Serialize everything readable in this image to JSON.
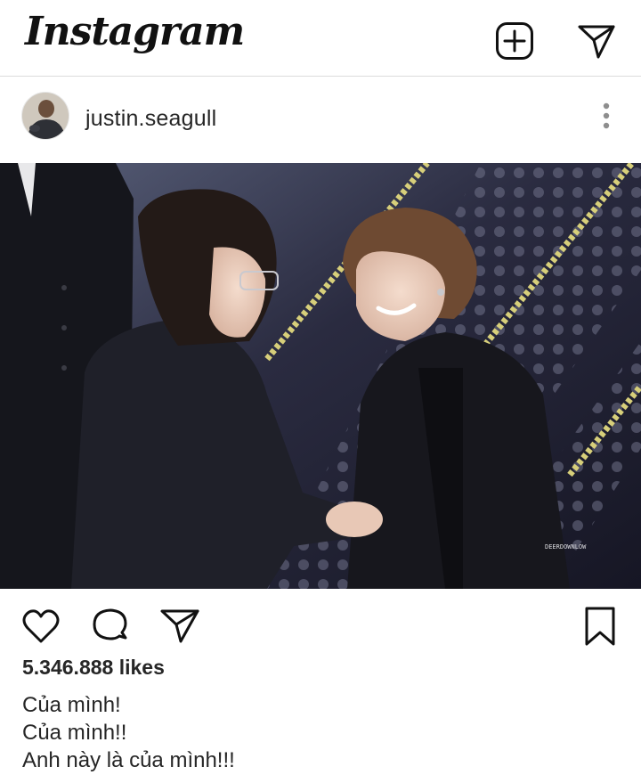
{
  "app": {
    "logo_text": "Instagram"
  },
  "topbar": {
    "icons": [
      "new-post-icon",
      "direct-message-icon"
    ]
  },
  "post": {
    "username": "justin.seagull",
    "likes": "5.346.888 likes",
    "caption_lines": [
      "Của mình!",
      "Của mình!!",
      "Anh này là của mình!!!"
    ],
    "watermark": "DEERDOWNLOW"
  },
  "actions": {
    "icons": [
      "heart-icon",
      "comment-icon",
      "share-icon",
      "bookmark-icon",
      "more-options-icon"
    ]
  },
  "colors": {
    "text": "#262626",
    "border": "#dbdbdb",
    "background": "#ffffff"
  }
}
